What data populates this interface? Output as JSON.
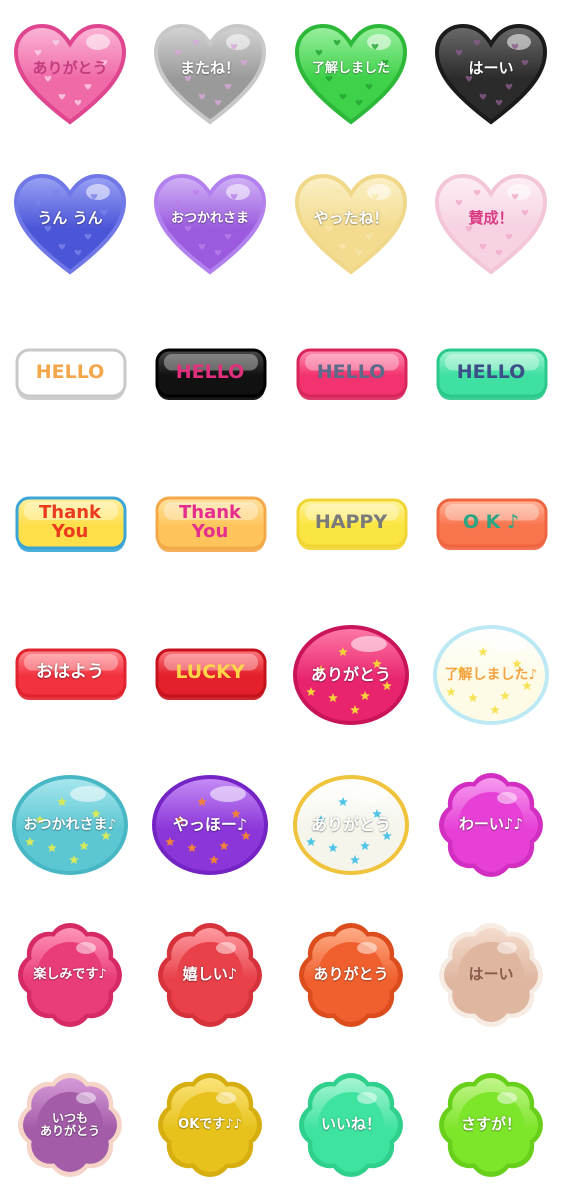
{
  "stickers": [
    {
      "text": "ありがとう",
      "shape": "heart",
      "fill": "#f06aa8",
      "fill2": "#fbb6d6",
      "stroke": "#e0468f",
      "textColor": "#c23b7e",
      "deco": "hearts",
      "decoColor": "#fdd2e6",
      "icon": "heart-sticker-icon"
    },
    {
      "text": "またね！",
      "shape": "heart",
      "fill": "#9a9a9a",
      "fill2": "#d4d4d4",
      "stroke": "#c8c8c8",
      "textColor": "#ffffff",
      "deco": "hearts",
      "decoColor": "#d7a7d8",
      "icon": "heart-sticker-icon"
    },
    {
      "text": "了解しました",
      "shape": "heart",
      "fill": "#3fd14a",
      "fill2": "#9af09f",
      "stroke": "#2db83a",
      "textColor": "#ffffff",
      "deco": "hearts",
      "decoColor": "#22a32e",
      "icon": "heart-sticker-icon"
    },
    {
      "text": "はーい",
      "shape": "heart",
      "fill": "#2b2b2b",
      "fill2": "#6b6b6b",
      "stroke": "#1b1b1b",
      "textColor": "#ffffff",
      "deco": "hearts",
      "decoColor": "#8c5b8c",
      "icon": "heart-sticker-icon"
    },
    {
      "text": "うん うん",
      "shape": "heart",
      "fill": "#4b55d8",
      "fill2": "#9aa2f5",
      "stroke": "#6f78e6",
      "textColor": "#ffffff",
      "deco": "hearts",
      "decoColor": "#7b83ea",
      "icon": "heart-sticker-icon"
    },
    {
      "text": "おつかれさま",
      "shape": "heart",
      "fill": "#9a5bde",
      "fill2": "#d1b3f6",
      "stroke": "#b281ee",
      "textColor": "#ffffff",
      "deco": "hearts",
      "decoColor": "#b97fe8",
      "icon": "heart-sticker-icon"
    },
    {
      "text": "やったね！",
      "shape": "heart",
      "fill": "#f3dc8f",
      "fill2": "#fbf0c6",
      "stroke": "#f0d88a",
      "textColor": "#ffffff",
      "deco": "hearts",
      "decoColor": "#f7e6a9",
      "icon": "heart-sticker-icon"
    },
    {
      "text": "賛成！",
      "shape": "heart",
      "fill": "#f6d2e3",
      "fill2": "#fdeef5",
      "stroke": "#f2c6d8",
      "textColor": "#d93b83",
      "deco": "hearts",
      "decoColor": "#f1a9c9",
      "icon": "heart-sticker-icon"
    },
    {
      "text": "HELLO",
      "shape": "pill",
      "fill": "#ffffff",
      "fill2": "#ffffff",
      "stroke": "#c9c9c9",
      "textColor": "#f3a64a",
      "deco": "none",
      "decoColor": "#ffffff",
      "icon": "rounded-rect-sticker-icon"
    },
    {
      "text": "HELLO",
      "shape": "pill",
      "fill": "#111111",
      "fill2": "#4a4a4a",
      "stroke": "#000000",
      "textColor": "#e0307d",
      "deco": "none",
      "decoColor": "#ffffff",
      "icon": "rounded-rect-sticker-icon"
    },
    {
      "text": "HELLO",
      "shape": "pill",
      "fill": "#f3336f",
      "fill2": "#ff8fb0",
      "stroke": "#d8255c",
      "textColor": "#5c6b8a",
      "deco": "none",
      "decoColor": "#ffffff",
      "icon": "rounded-rect-sticker-icon"
    },
    {
      "text": "HELLO",
      "shape": "pill",
      "fill": "#3fe0a2",
      "fill2": "#a4f5d3",
      "stroke": "#2bc88b",
      "textColor": "#3d4f88",
      "deco": "none",
      "decoColor": "#ffffff",
      "icon": "rounded-rect-sticker-icon"
    },
    {
      "text": "Thank\n You",
      "shape": "pill",
      "fill": "#ffdf4a",
      "fill2": "#fff1a0",
      "stroke": "#3ba6d6",
      "textColor": "#ea3b1e",
      "deco": "none",
      "decoColor": "#ffffff",
      "icon": "rounded-rect-sticker-icon"
    },
    {
      "text": "Thank\n You",
      "shape": "pill",
      "fill": "#ffc55c",
      "fill2": "#ffe3a0",
      "stroke": "#f4a948",
      "textColor": "#e52d8e",
      "deco": "none",
      "decoColor": "#ffffff",
      "icon": "rounded-rect-sticker-icon"
    },
    {
      "text": "HAPPY",
      "shape": "pill",
      "fill": "#fbe542",
      "fill2": "#fff39c",
      "stroke": "#f0d534",
      "textColor": "#7a7a7a",
      "deco": "none",
      "decoColor": "#ffffff",
      "icon": "rounded-rect-sticker-icon"
    },
    {
      "text": "O K ♪",
      "shape": "pill",
      "fill": "#f9754e",
      "fill2": "#ffb59b",
      "stroke": "#ef6540",
      "textColor": "#2aa682",
      "deco": "none",
      "decoColor": "#ffffff",
      "icon": "rounded-rect-sticker-icon"
    },
    {
      "text": "おはよう",
      "shape": "pill",
      "fill": "#f3323f",
      "fill2": "#ff8d93",
      "stroke": "#e0232f",
      "textColor": "#ffffff",
      "deco": "none",
      "decoColor": "#ffffff",
      "icon": "rounded-rect-sticker-icon"
    },
    {
      "text": "LUCKY",
      "shape": "pill",
      "fill": "#e3202b",
      "fill2": "#ff7a80",
      "stroke": "#c5121c",
      "textColor": "#ffd54a",
      "deco": "none",
      "decoColor": "#ffffff",
      "icon": "rounded-rect-sticker-icon"
    },
    {
      "text": "ありがとう",
      "shape": "oval",
      "fill": "#e8246f",
      "fill2": "#ff7aa8",
      "stroke": "#c9145a",
      "textColor": "#ffffff",
      "deco": "stars",
      "decoColor": "#f7d23a",
      "icon": "oval-sticker-icon"
    },
    {
      "text": "了解しました♪",
      "shape": "oval",
      "fill": "#fdfbe6",
      "fill2": "#ffffff",
      "stroke": "#bde9f4",
      "textColor": "#f3a23f",
      "deco": "stars",
      "decoColor": "#f7e35a",
      "icon": "oval-sticker-icon"
    },
    {
      "text": "おつかれさま♪",
      "shape": "oval",
      "fill": "#5cc7d3",
      "fill2": "#a9e7ee",
      "stroke": "#48b7c4",
      "textColor": "#ffffff",
      "deco": "stars",
      "decoColor": "#d8ea5a",
      "icon": "oval-sticker-icon"
    },
    {
      "text": "やっほー♪",
      "shape": "oval",
      "fill": "#8a36d8",
      "fill2": "#c78ef7",
      "stroke": "#7424c4",
      "textColor": "#ffffff",
      "deco": "stars",
      "decoColor": "#f0813a",
      "icon": "oval-sticker-icon"
    },
    {
      "text": "ありがとう",
      "shape": "oval",
      "fill": "#f5f5ec",
      "fill2": "#ffffff",
      "stroke": "#efc33b",
      "textColor": "#ffffff",
      "deco": "stars",
      "decoColor": "#4fc4e6",
      "icon": "oval-sticker-icon"
    },
    {
      "text": "わーい♪♪",
      "shape": "flower",
      "fill": "#e640d6",
      "fill2": "#f79af0",
      "stroke": "#d22fc2",
      "textColor": "#ffffff",
      "deco": "none",
      "decoColor": "#ffffff",
      "icon": "flower-sticker-icon"
    },
    {
      "text": "楽しみです♪",
      "shape": "flower",
      "fill": "#e93c7a",
      "fill2": "#ff94b8",
      "stroke": "#d62a67",
      "textColor": "#ffffff",
      "deco": "none",
      "decoColor": "#ffffff",
      "icon": "flower-sticker-icon"
    },
    {
      "text": "嬉しい♪",
      "shape": "flower",
      "fill": "#e8414a",
      "fill2": "#ff9aa0",
      "stroke": "#d5323b",
      "textColor": "#ffffff",
      "deco": "none",
      "decoColor": "#ffffff",
      "icon": "flower-sticker-icon"
    },
    {
      "text": "ありがとう",
      "shape": "flower",
      "fill": "#f0602e",
      "fill2": "#ffac86",
      "stroke": "#dc4d1d",
      "textColor": "#ffffff",
      "deco": "none",
      "decoColor": "#ffffff",
      "icon": "flower-sticker-icon"
    },
    {
      "text": "はーい",
      "shape": "flower",
      "fill": "#dfb7a1",
      "fill2": "#f4dccd",
      "stroke": "#f7ece4",
      "textColor": "#8a5a4a",
      "deco": "none",
      "decoColor": "#ffffff",
      "icon": "flower-sticker-icon"
    },
    {
      "text": "いつも\nありがとう",
      "shape": "flower",
      "fill": "#a35ca8",
      "fill2": "#d59ad8",
      "stroke": "#f6d5c8",
      "textColor": "#ffffff",
      "deco": "none",
      "decoColor": "#ffffff",
      "icon": "flower-sticker-icon"
    },
    {
      "text": "OKです♪♪",
      "shape": "flower",
      "fill": "#e7c21c",
      "fill2": "#fbe37a",
      "stroke": "#d6ae10",
      "textColor": "#ffffff",
      "deco": "none",
      "decoColor": "#ffffff",
      "icon": "flower-sticker-icon"
    },
    {
      "text": "いいね！",
      "shape": "flower",
      "fill": "#3fe3a0",
      "fill2": "#a5f5d2",
      "stroke": "#2fcf8c",
      "textColor": "#ffffff",
      "deco": "none",
      "decoColor": "#ffffff",
      "icon": "flower-sticker-icon"
    },
    {
      "text": "さすが！",
      "shape": "flower",
      "fill": "#7de52a",
      "fill2": "#c2f58c",
      "stroke": "#68cf1b",
      "textColor": "#ffffff",
      "deco": "none",
      "decoColor": "#ffffff",
      "icon": "flower-sticker-icon"
    }
  ]
}
